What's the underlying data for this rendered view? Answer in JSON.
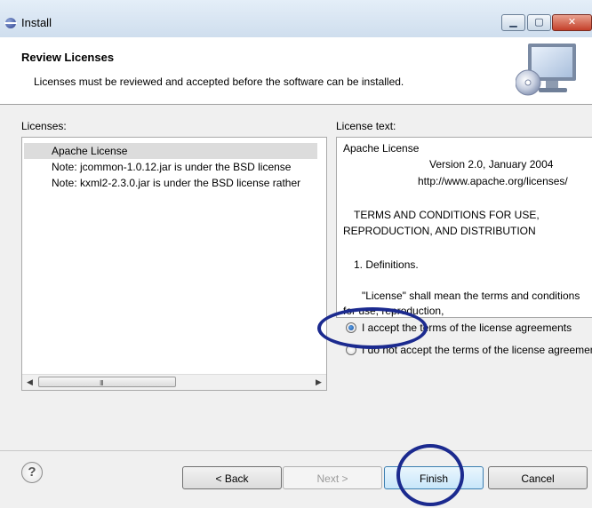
{
  "window": {
    "title": "Install",
    "icon": "eclipse-icon",
    "controls": {
      "minimize": "▁",
      "maximize": "▢",
      "close": "✕"
    }
  },
  "header": {
    "title": "Review Licenses",
    "description": "Licenses must be reviewed and accepted before the software can be installed.",
    "icon": "monitor-cd-icon"
  },
  "licenses": {
    "label": "Licenses:",
    "items": [
      "Apache License",
      "Note:  jcommon-1.0.12.jar is under the BSD license",
      "Note:  kxml2-2.3.0.jar is under the BSD license rather"
    ],
    "selected_index": 0,
    "scroll": {
      "left": "◀",
      "right": "▶",
      "grip": "III"
    }
  },
  "license_text": {
    "label": "License text:",
    "lines": [
      "Apache License",
      "Version 2.0, January 2004",
      "http://www.apache.org/licenses/",
      "TERMS AND CONDITIONS FOR USE,",
      "REPRODUCTION, AND DISTRIBUTION",
      "1. Definitions.",
      "\"License\" shall mean the terms and conditions",
      "for use, reproduction,"
    ]
  },
  "acceptance": {
    "accept_label": "I accept the terms of the license agreements",
    "decline_label": "I do not accept the terms of the license agreements",
    "selected": "accept"
  },
  "footer": {
    "help": "?",
    "back_label": "< Back",
    "next_label": "Next >",
    "finish_label": "Finish",
    "cancel_label": "Cancel"
  },
  "colors": {
    "annotation": "#1b2a8f",
    "selection": "#dcdcdc"
  }
}
